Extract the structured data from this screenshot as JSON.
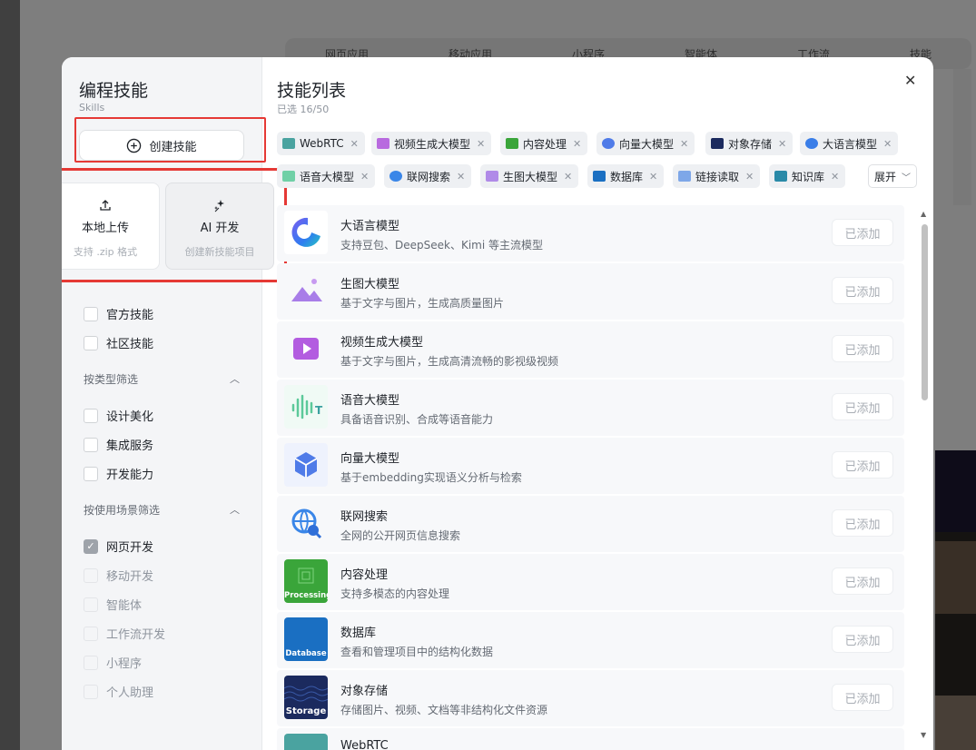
{
  "background_tabs": [
    "网页应用",
    "移动应用",
    "小程序",
    "智能体",
    "工作流",
    "技能"
  ],
  "sidebar": {
    "title": "编程技能",
    "subtitle": "Skills",
    "create_label": "创建技能",
    "upload": {
      "label": "本地上传",
      "desc": "支持 .zip 格式"
    },
    "ai": {
      "label": "AI 开发",
      "desc": "创建新技能项目"
    },
    "source_filters": [
      "官方技能",
      "社区技能"
    ],
    "type_group": "按类型筛选",
    "type_filters": [
      "设计美化",
      "集成服务",
      "开发能力"
    ],
    "scene_group": "按使用场景筛选",
    "scene_filters": [
      "网页开发",
      "移动开发",
      "智能体",
      "工作流开发",
      "小程序",
      "个人助理"
    ]
  },
  "main": {
    "title": "技能列表",
    "selected_count": "已选 16/50",
    "expand_label": "展开",
    "chips": [
      "WebRTC",
      "视频生成大模型",
      "内容处理",
      "向量大模型",
      "对象存储",
      "大语言模型",
      "语音大模型",
      "联网搜索",
      "生图大模型",
      "数据库",
      "链接读取",
      "知识库"
    ],
    "added_label": "已添加",
    "skills": [
      {
        "name": "大语言模型",
        "desc": "支持豆包、DeepSeek、Kimi 等主流模型"
      },
      {
        "name": "生图大模型",
        "desc": "基于文字与图片，生成高质量图片"
      },
      {
        "name": "视频生成大模型",
        "desc": "基于文字与图片，生成高清流畅的影视级视频"
      },
      {
        "name": "语音大模型",
        "desc": "具备语音识别、合成等语音能力"
      },
      {
        "name": "向量大模型",
        "desc": "基于embedding实现语义分析与检索"
      },
      {
        "name": "联网搜索",
        "desc": "全网的公开网页信息搜索"
      },
      {
        "name": "内容处理",
        "desc": "支持多模态的内容处理",
        "badge": "Processing"
      },
      {
        "name": "数据库",
        "desc": "查看和管理项目中的结构化数据",
        "badge": "Database"
      },
      {
        "name": "对象存储",
        "desc": "存储图片、视频、文档等非结构化文件资源",
        "badge": "Storage"
      },
      {
        "name": "WebRTC",
        "desc": ""
      }
    ]
  },
  "colors": {
    "highlight": "#e53935",
    "processing": "#3aa53a",
    "database": "#1a6fc2",
    "storage": "#1b2a5e",
    "webrtc": "#4aa3a0"
  }
}
